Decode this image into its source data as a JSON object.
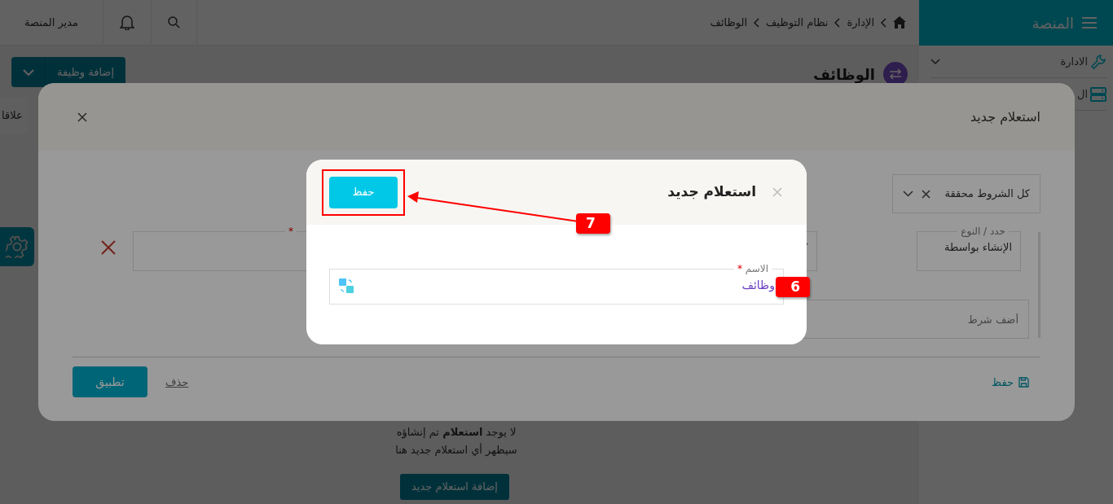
{
  "sidebar": {
    "title": "المنصة",
    "items": [
      {
        "label": "الادارة"
      },
      {
        "label": "ال"
      }
    ]
  },
  "topbar": {
    "breadcrumb": [
      "الإدارة",
      "نظام التوظيف",
      "الوظائف"
    ],
    "user": "مدير المنصة"
  },
  "page": {
    "title": "الوظائف",
    "add_button": "إضافة وظيفة",
    "side_tab": "علاقا",
    "empty_message": "لا يوجد **استعلام** تم إنشاؤه",
    "empty_hint": "سيظهر أي استعلام جديد هنا",
    "new_button": "إضافة استعلام جديد"
  },
  "query_dialog": {
    "title": "استعلام جديد",
    "match_select": "كل الشروط محققة",
    "condition": {
      "label": "حدد / النوع",
      "value": "الإنشاء بواسطة"
    },
    "value_required_mark": "*",
    "add_condition_placeholder": "أضف شرط",
    "footer": {
      "save": "حفظ",
      "delete": "حذف",
      "apply": "تطبيق"
    }
  },
  "name_dialog": {
    "title": "استعلام جديد",
    "save": "حفظ",
    "name_label": "الاسم",
    "required_mark": "*",
    "name_value": "وظائف"
  },
  "annotations": [
    {
      "label": "7"
    },
    {
      "label": "6"
    }
  ]
}
